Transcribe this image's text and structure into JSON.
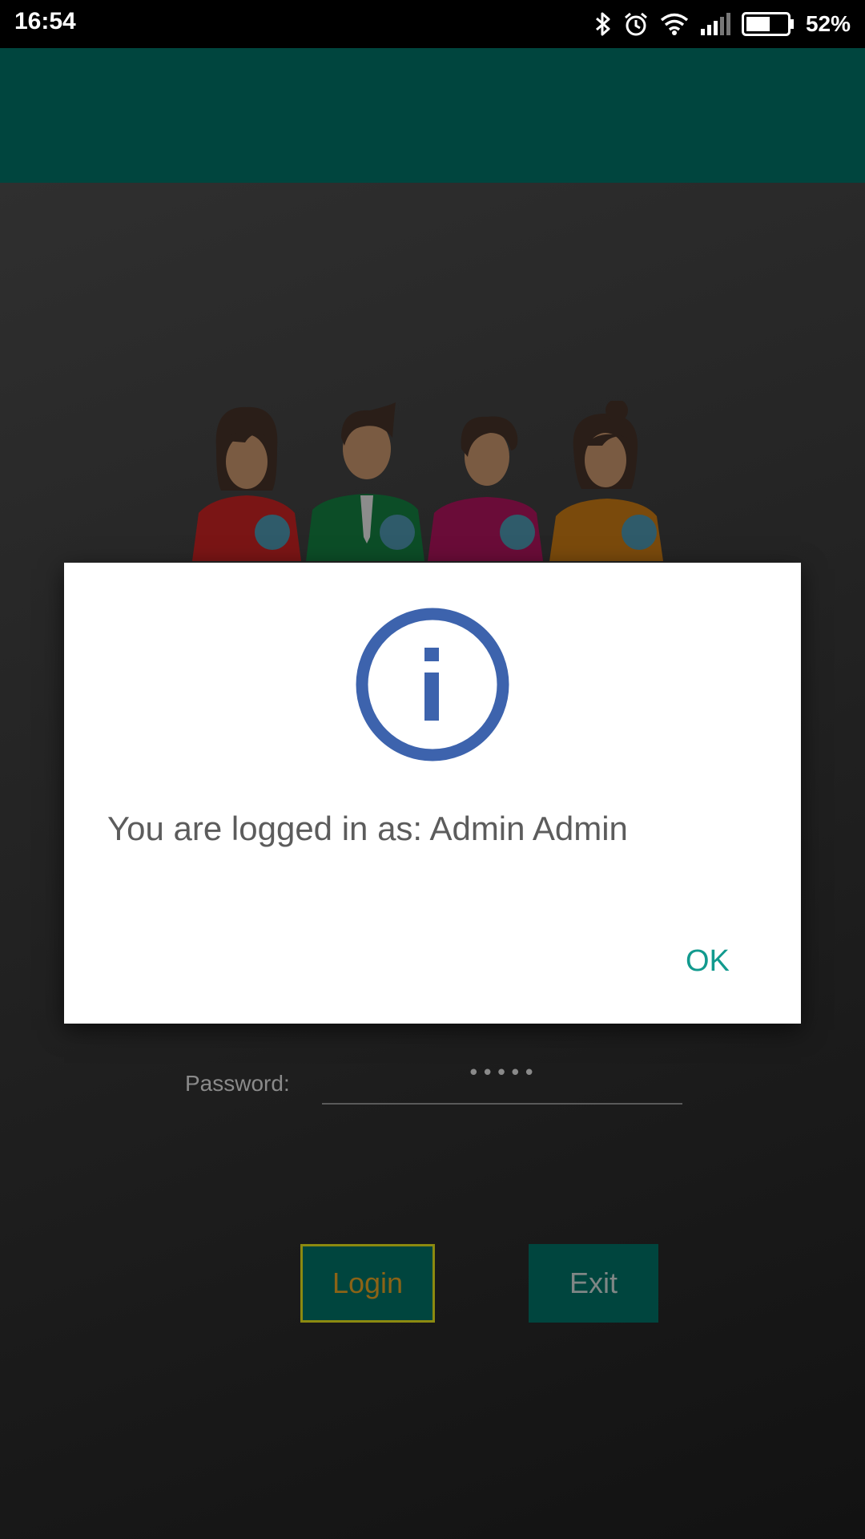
{
  "status_bar": {
    "time": "16:54",
    "battery_percent": "52%",
    "icons": [
      "bluetooth-icon",
      "alarm-icon",
      "wifi-icon",
      "signal-icon",
      "battery-icon"
    ]
  },
  "login_form": {
    "password_label": "Password:",
    "password_value": "•••••",
    "login_button": "Login",
    "exit_button": "Exit"
  },
  "dialog": {
    "icon": "info-icon",
    "message": "You are logged in as: Admin Admin",
    "ok_button": "OK"
  },
  "colors": {
    "app_bar": "#00453e",
    "dialog_icon": "#3d63ad",
    "dialog_action": "#129a8e"
  }
}
